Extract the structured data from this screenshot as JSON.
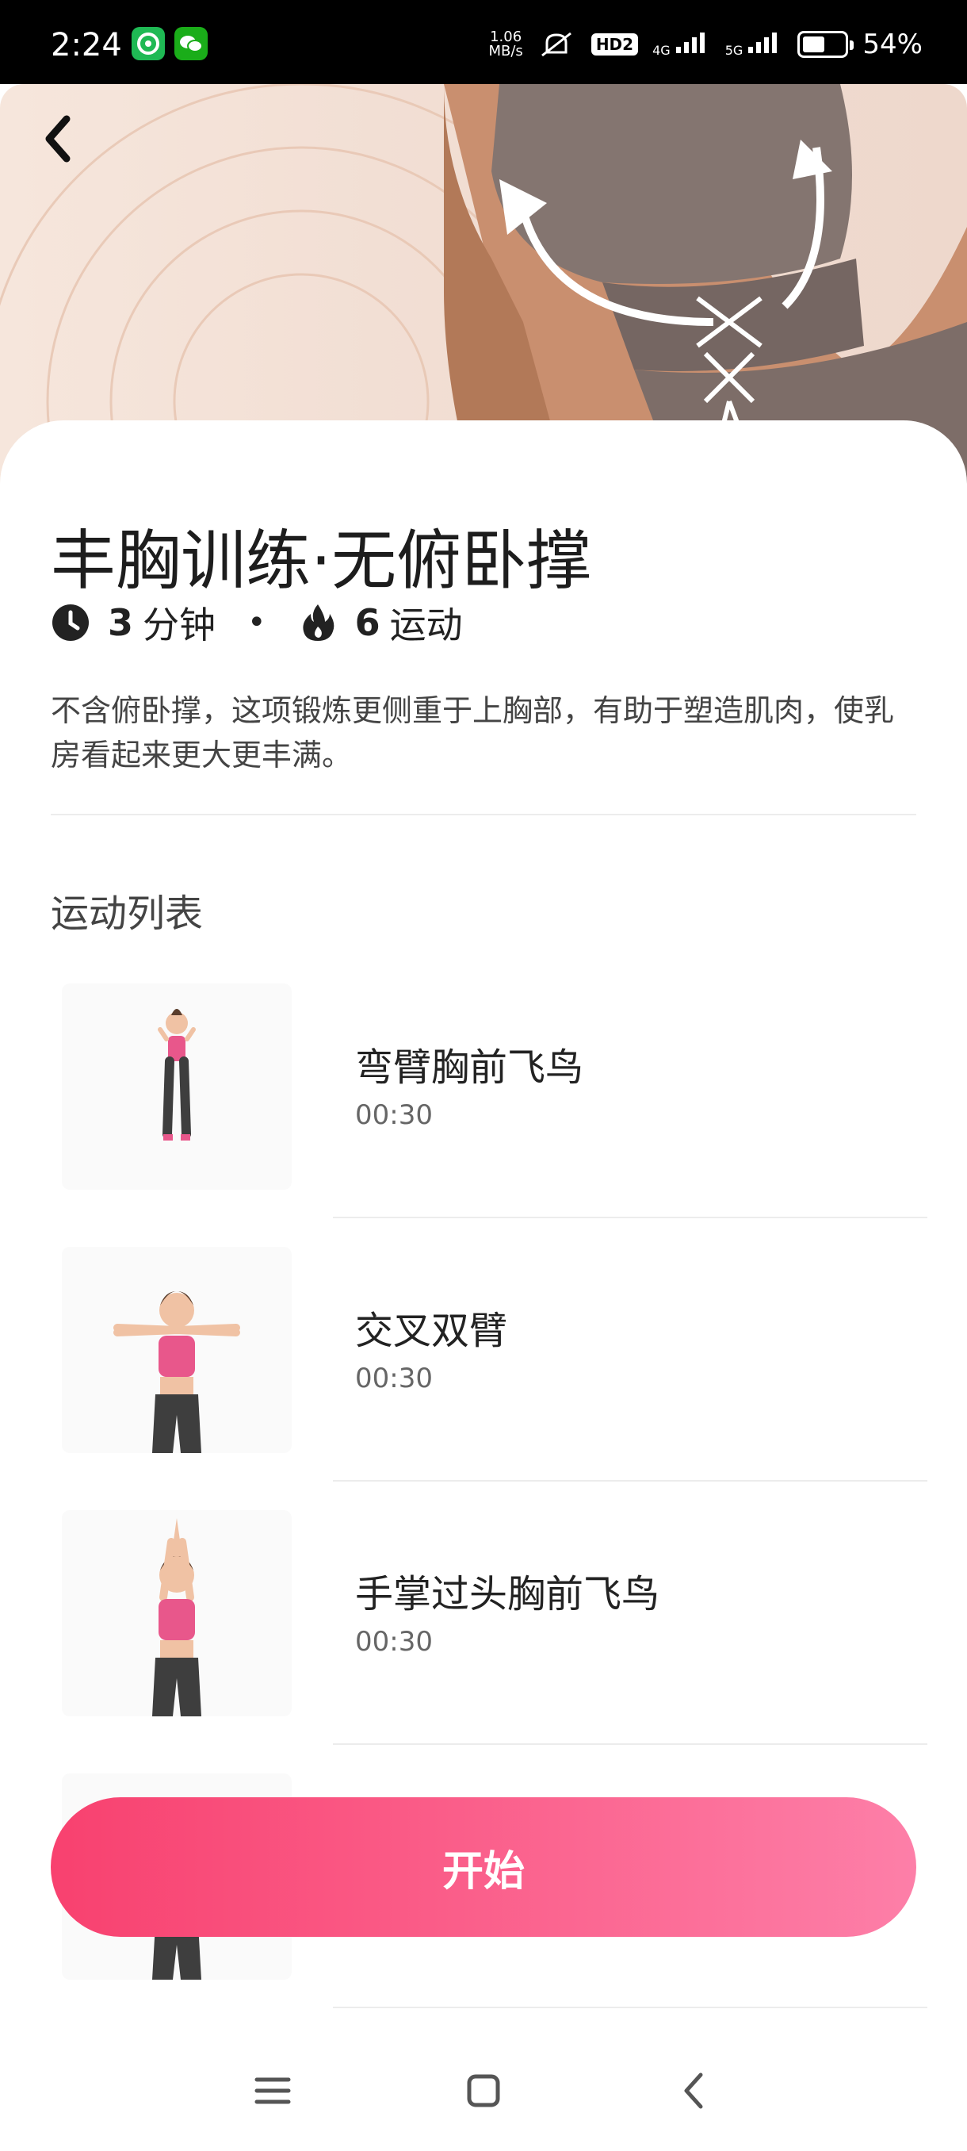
{
  "status_bar": {
    "time": "2:24",
    "speed_value": "1.06",
    "speed_unit": "MB/s",
    "hd_label": "HD2",
    "net1": "4G",
    "net2": "5G",
    "battery": "54%",
    "battery_level": 0.54
  },
  "workout": {
    "title": "丰胸训练·无俯卧撑",
    "duration_value": "3",
    "duration_unit": "分钟",
    "exercise_count": "6",
    "exercise_unit": "运动",
    "description": "不含俯卧撑，这项锻炼更侧重于上胸部，有助于塑造肌肉，使乳房看起来更大更丰满。"
  },
  "section_title": "运动列表",
  "exercises": [
    {
      "name": "弯臂胸前飞鸟",
      "time": "00:30"
    },
    {
      "name": "交叉双臂",
      "time": "00:30"
    },
    {
      "name": "手掌过头胸前飞鸟",
      "time": "00:30"
    }
  ],
  "start_button": "开始",
  "colors": {
    "accent_start": "#f8416f",
    "accent_end": "#fd7fa8"
  }
}
